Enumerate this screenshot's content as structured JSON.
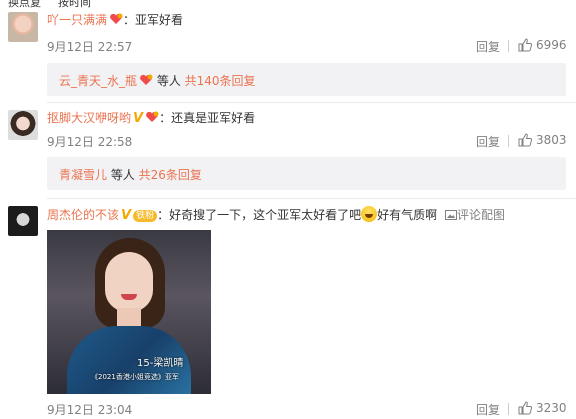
{
  "top_strip": {
    "left": "换点复",
    "right": "按时间"
  },
  "comments": [
    {
      "user": "吖一只满满",
      "badges": [
        "fan-heart-icon"
      ],
      "text": "：亚军好看",
      "time": "9月12日 22:57",
      "reply_label": "回复",
      "likes": "6996",
      "sub_replies": {
        "user": "云_青天_水_瓶",
        "suffix": " 等人 ",
        "more": "共140条回复"
      }
    },
    {
      "user": "抠脚大汉咿呀哟",
      "badges": [
        "verified-v-icon",
        "fan-heart-icon"
      ],
      "text": "：还真是亚军好看",
      "time": "9月12日 22:58",
      "reply_label": "回复",
      "likes": "3803",
      "sub_replies": {
        "user": "青凝雪儿",
        "suffix": " 等人 ",
        "more": "共26条回复"
      }
    },
    {
      "user": "周杰伦的不该",
      "badges": [
        "verified-v-icon",
        "fan-badge"
      ],
      "fan_badge": "铁粉",
      "text": "：好奇搜了一下，这个亚军太好看了吧",
      "text_after": "好有气质啊",
      "pic_comment_label": "评论配图",
      "photo_caption": "15-梁凯晴",
      "photo_subcaption": "《2021香港小姐竞选》亚军",
      "time": "9月12日 23:04",
      "reply_label": "回复",
      "likes": "3230"
    }
  ],
  "colors": {
    "username": "#eb7350",
    "meta": "#808080",
    "subbox_bg": "#f2f2f5",
    "verified": "#f5a800"
  }
}
